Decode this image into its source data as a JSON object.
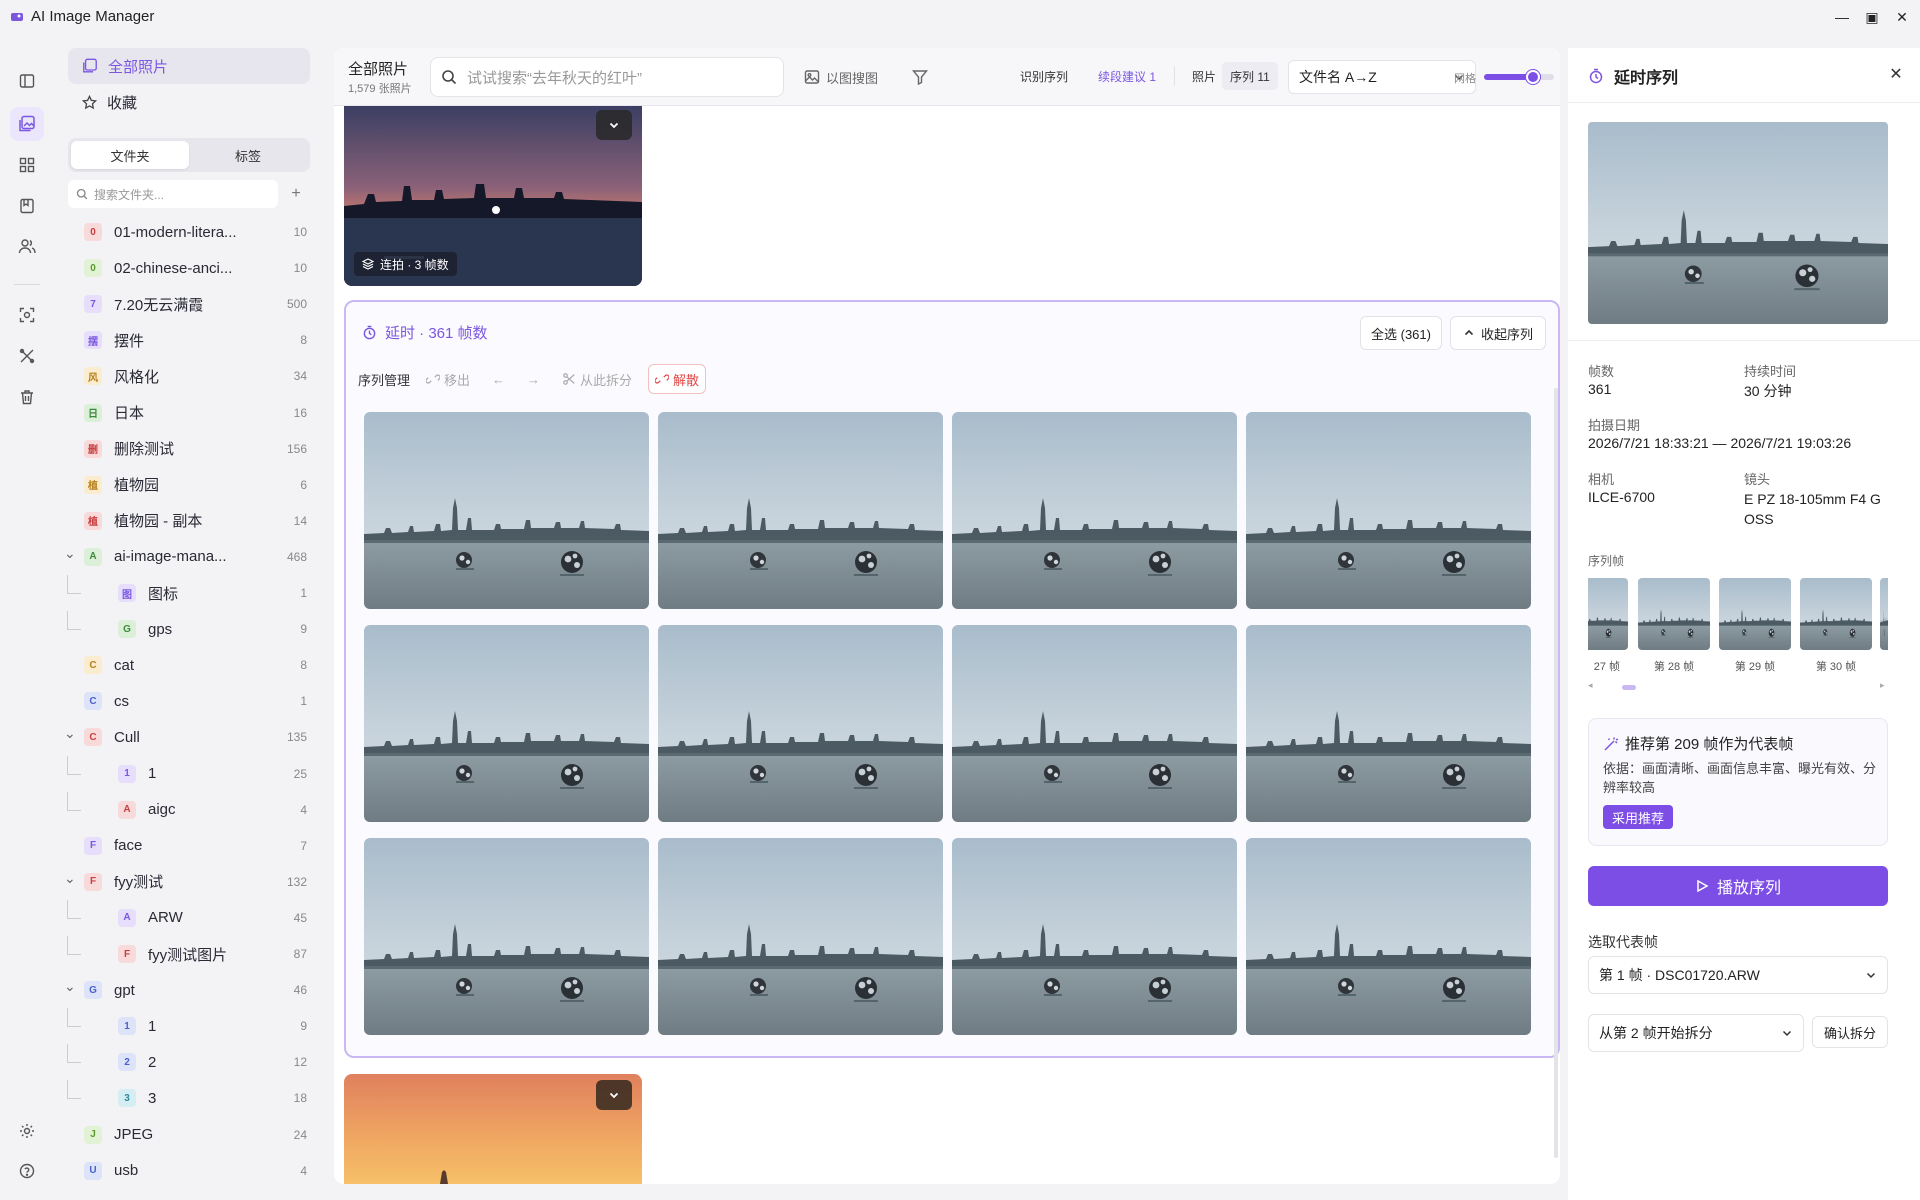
{
  "window": {
    "title": "AI Image Manager",
    "minimize": "—",
    "maximize": "▣",
    "close": "✕"
  },
  "nav": {
    "all_photos": "全部照片",
    "favorites": "收藏"
  },
  "tabs": {
    "folders": "文件夹",
    "tags": "标签"
  },
  "folder_search": {
    "placeholder": "搜索文件夹..."
  },
  "folders": [
    {
      "badge": "0",
      "name": "01-modern-litera...",
      "count": "10",
      "color": "#f8dada",
      "fg": "#c94040",
      "level": 0
    },
    {
      "badge": "0",
      "name": "02-chinese-anci...",
      "count": "10",
      "color": "#e2f2d5",
      "fg": "#5c9a2f",
      "level": 0
    },
    {
      "badge": "7",
      "name": "7.20无云满霞",
      "count": "500",
      "color": "#e6defa",
      "fg": "#7b57e0",
      "level": 0
    },
    {
      "badge": "摆",
      "name": "摆件",
      "count": "8",
      "color": "#e6defa",
      "fg": "#7b57e0",
      "level": 0
    },
    {
      "badge": "风",
      "name": "风格化",
      "count": "34",
      "color": "#faeccf",
      "fg": "#b9801e",
      "level": 0
    },
    {
      "badge": "日",
      "name": "日本",
      "count": "16",
      "color": "#dcefd9",
      "fg": "#3f8a3a",
      "level": 0
    },
    {
      "badge": "删",
      "name": "删除测试",
      "count": "156",
      "color": "#f8dada",
      "fg": "#c94040",
      "level": 0
    },
    {
      "badge": "植",
      "name": "植物园",
      "count": "6",
      "color": "#faeccf",
      "fg": "#b9801e",
      "level": 0
    },
    {
      "badge": "植",
      "name": "植物园 - 副本",
      "count": "14",
      "color": "#f8dada",
      "fg": "#c94040",
      "level": 0
    },
    {
      "badge": "A",
      "name": "ai-image-mana...",
      "count": "468",
      "color": "#dcefd9",
      "fg": "#3f8a3a",
      "level": 0,
      "expanded": true
    },
    {
      "badge": "图",
      "name": "图标",
      "count": "1",
      "color": "#e6defa",
      "fg": "#7b57e0",
      "level": 1
    },
    {
      "badge": "G",
      "name": "gps",
      "count": "9",
      "color": "#dcefd9",
      "fg": "#3f8a3a",
      "level": 1
    },
    {
      "badge": "C",
      "name": "cat",
      "count": "8",
      "color": "#faeccf",
      "fg": "#b9801e",
      "level": 0
    },
    {
      "badge": "C",
      "name": "cs",
      "count": "1",
      "color": "#dde3f8",
      "fg": "#4a63c9",
      "level": 0
    },
    {
      "badge": "C",
      "name": "Cull",
      "count": "135",
      "color": "#f8dada",
      "fg": "#c94040",
      "level": 0,
      "expanded": true
    },
    {
      "badge": "1",
      "name": "1",
      "count": "25",
      "color": "#e6defa",
      "fg": "#7b57e0",
      "level": 1
    },
    {
      "badge": "A",
      "name": "aigc",
      "count": "4",
      "color": "#f8dada",
      "fg": "#c94040",
      "level": 1
    },
    {
      "badge": "F",
      "name": "face",
      "count": "7",
      "color": "#e6defa",
      "fg": "#7b57e0",
      "level": 0
    },
    {
      "badge": "F",
      "name": "fyy测试",
      "count": "132",
      "color": "#f8dada",
      "fg": "#c94040",
      "level": 0,
      "expanded": true
    },
    {
      "badge": "A",
      "name": "ARW",
      "count": "45",
      "color": "#e6defa",
      "fg": "#7b57e0",
      "level": 1
    },
    {
      "badge": "F",
      "name": "fyy测试图片",
      "count": "87",
      "color": "#f8dada",
      "fg": "#c94040",
      "level": 1
    },
    {
      "badge": "G",
      "name": "gpt",
      "count": "46",
      "color": "#dde3f8",
      "fg": "#4a63c9",
      "level": 0,
      "expanded": true
    },
    {
      "badge": "1",
      "name": "1",
      "count": "9",
      "color": "#dde3f8",
      "fg": "#4a63c9",
      "level": 1
    },
    {
      "badge": "2",
      "name": "2",
      "count": "12",
      "color": "#dde3f8",
      "fg": "#4a63c9",
      "level": 1
    },
    {
      "badge": "3",
      "name": "3",
      "count": "18",
      "color": "#d5eef4",
      "fg": "#2f8aa0",
      "level": 1
    },
    {
      "badge": "J",
      "name": "JPEG",
      "count": "24",
      "color": "#e2f2d5",
      "fg": "#5c9a2f",
      "level": 0
    },
    {
      "badge": "U",
      "name": "usb",
      "count": "4",
      "color": "#dde3f8",
      "fg": "#4a63c9",
      "level": 0
    }
  ],
  "toolbar": {
    "title": "全部照片",
    "subtitle": "1,579 张照片",
    "search_placeholder": "试试搜索“去年秋天的红叶”",
    "image_search": "以图搜图",
    "detect_seq": "识别序列",
    "continue_suggest": "续段建议 1",
    "view_photos": "照片",
    "view_seq": "序列 11",
    "sort": "文件名 A→Z",
    "grid_label": "网格",
    "grid_level": 0.7
  },
  "burst_card": {
    "label": "连拍 · 3 帧数"
  },
  "sequence": {
    "title": "延时 · 361 帧数",
    "select_all": "全选 (361)",
    "collapse": "收起序列",
    "manage": "序列管理",
    "remove": "移出",
    "split_here": "从此拆分",
    "dissolve": "解散"
  },
  "panel": {
    "title": "延时序列",
    "frames_label": "帧数",
    "frames_value": "361",
    "duration_label": "持续时间",
    "duration_value": "30 分钟",
    "date_label": "拍摄日期",
    "date_value": "2026/7/21 18:33:21 — 2026/7/21 19:03:26",
    "camera_label": "相机",
    "camera_value": "ILCE-6700",
    "lens_label": "镜头",
    "lens_value": "E PZ 18-105mm F4 G OSS",
    "seq_frames_label": "序列帧",
    "thumb_labels": [
      "27 帧",
      "第 28 帧",
      "第 29 帧",
      "第 30 帧"
    ],
    "reco_title": "推荐第 209 帧作为代表帧",
    "reco_body": "依据：画面清晰、画面信息丰富、曝光有效、分辨率较高",
    "reco_adopt": "采用推荐",
    "play": "播放序列",
    "pick_label": "选取代表帧",
    "pick_value": "第 1 帧 · DSC01720.ARW",
    "split_value": "从第 2 帧开始拆分",
    "split_confirm": "确认拆分"
  },
  "colors": {
    "accent": "#7c4ee6",
    "accent_light": "#ebe6fb",
    "danger": "#e04848"
  }
}
